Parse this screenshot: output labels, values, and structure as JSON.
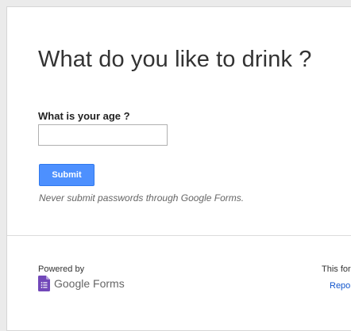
{
  "form": {
    "title": "What do you like to drink ?",
    "question_label": "What is your age ?",
    "age_value": "",
    "submit_label": "Submit",
    "warning": "Never submit passwords through Google Forms."
  },
  "footer": {
    "powered_by": "Powered by",
    "brand_name": "Google Forms",
    "brand_icon": "google-forms-icon",
    "right_notice": "This for",
    "report_link": "Repor"
  },
  "colors": {
    "submit_button": "#4d90fe",
    "forms_icon": "#7248b9",
    "link": "#1155cc",
    "page_background": "#ebebeb"
  }
}
